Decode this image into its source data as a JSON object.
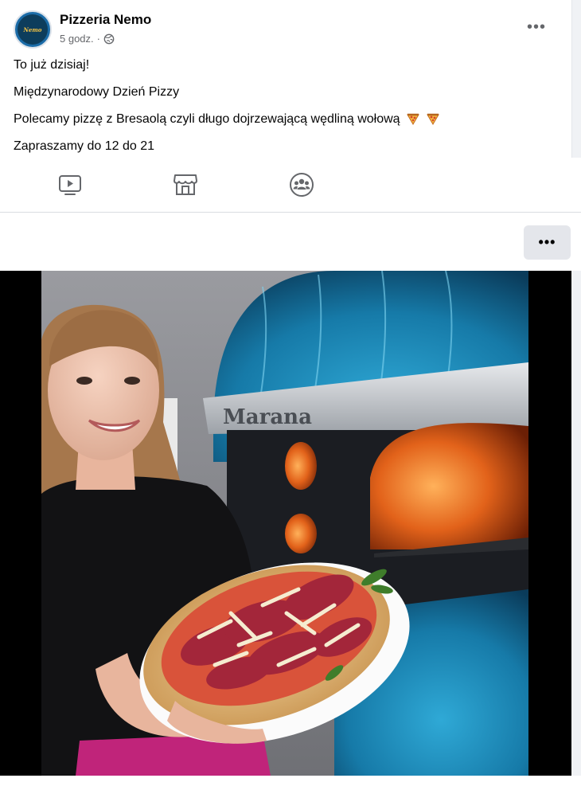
{
  "post": {
    "page_name": "Pizzeria Nemo",
    "time": "5 godz.",
    "separator": "·",
    "avatar_text": "Nemo",
    "lines": [
      "To już dzisiaj!",
      "Międzynarodowy Dzień Pizzy",
      "Polecamy pizzę z Bresaolą czyli długo dojrzewającą wędliną wołową",
      "Zapraszamy do 12 do 21"
    ],
    "more_label": "•••"
  },
  "nav": {
    "icons": [
      "video-icon",
      "marketplace-icon",
      "groups-icon"
    ]
  },
  "options_label": "•••",
  "photo": {
    "oven_brand": "Marana"
  },
  "colors": {
    "background": "#f0f2f5",
    "card": "#ffffff",
    "text": "#050505",
    "secondary": "#65676b",
    "button": "#e4e6eb"
  }
}
